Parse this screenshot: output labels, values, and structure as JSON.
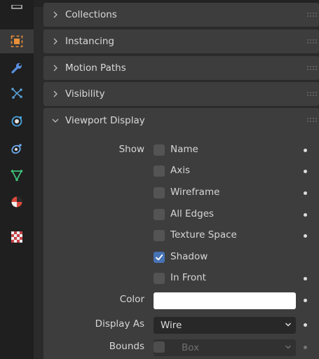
{
  "colors": {
    "accent": "#4772b3",
    "panel_bg": "#3d3d3d",
    "tabbar_bg": "#1f1f1f",
    "object_tab_orange": "#e8903a",
    "wrench_blue": "#5a8fe0",
    "particles_blue": "#56a0d6",
    "physics_blue": "#4aa3e0",
    "constraints_blue": "#6aa6e8",
    "data_green": "#3fc07a",
    "material_red": "#d84a3c",
    "texture_red": "#c5444a"
  },
  "tabs": [
    {
      "icon": "object-icon"
    },
    {
      "icon": "wrench-icon"
    },
    {
      "icon": "particles-icon"
    },
    {
      "icon": "physics-icon"
    },
    {
      "icon": "constraints-icon"
    },
    {
      "icon": "object-data-icon"
    },
    {
      "icon": "material-icon"
    },
    {
      "icon": "texture-icon"
    }
  ],
  "panels": {
    "collections": "Collections",
    "instancing": "Instancing",
    "motion_paths": "Motion Paths",
    "visibility": "Visibility",
    "viewport_display": "Viewport Display"
  },
  "viewport_display": {
    "show_label": "Show",
    "options": [
      {
        "label": "Name",
        "checked": false
      },
      {
        "label": "Axis",
        "checked": false
      },
      {
        "label": "Wireframe",
        "checked": false
      },
      {
        "label": "All Edges",
        "checked": false
      },
      {
        "label": "Texture Space",
        "checked": false
      },
      {
        "label": "Shadow",
        "checked": true
      },
      {
        "label": "In Front",
        "checked": false
      }
    ],
    "color_label": "Color",
    "color_value": "#ffffff",
    "display_as_label": "Display As",
    "display_as_value": "Wire",
    "bounds_label": "Bounds",
    "bounds_value": "Box"
  }
}
